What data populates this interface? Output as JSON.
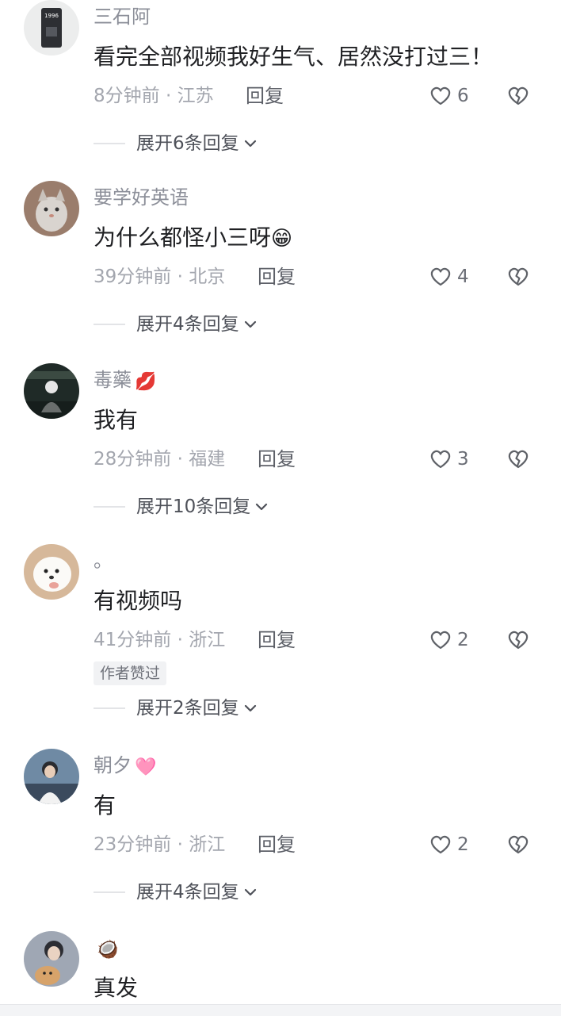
{
  "comments": [
    {
      "username": "三石阿",
      "badge": "",
      "text": "看完全部视频我好生气、居然没打过三！",
      "emoji": "",
      "time_location": "8分钟前 · 江苏",
      "reply_label": "回复",
      "likes": "6",
      "author_liked": "",
      "expand_label": "展开6条回复",
      "avatar": "avatar-1996-card"
    },
    {
      "username": "要学好英语",
      "badge": "",
      "text": "为什么都怪小三呀",
      "emoji": "😁",
      "time_location": "39分钟前 · 北京",
      "reply_label": "回复",
      "likes": "4",
      "author_liked": "",
      "expand_label": "展开4条回复",
      "avatar": "avatar-cat"
    },
    {
      "username": "毒藥",
      "badge": "💋",
      "text": "我有",
      "emoji": "",
      "time_location": "28分钟前 · 福建",
      "reply_label": "回复",
      "likes": "3",
      "author_liked": "",
      "expand_label": "展开10条回复",
      "avatar": "avatar-figure-dark"
    },
    {
      "username": "。",
      "badge": "",
      "text": "有视频吗",
      "emoji": "",
      "time_location": "41分钟前 · 浙江",
      "reply_label": "回复",
      "likes": "2",
      "author_liked": "作者赞过",
      "expand_label": "展开2条回复",
      "avatar": "avatar-white-dog"
    },
    {
      "username": "朝夕",
      "badge": "🩷",
      "text": "有",
      "emoji": "",
      "time_location": "23分钟前 · 浙江",
      "reply_label": "回复",
      "likes": "2",
      "author_liked": "",
      "expand_label": "展开4条回复",
      "avatar": "avatar-person"
    },
    {
      "username": "",
      "badge": "🥥",
      "text": "真发",
      "emoji": "",
      "time_location": "",
      "reply_label": "",
      "likes": "",
      "author_liked": "",
      "expand_label": "",
      "avatar": "avatar-pet-person"
    }
  ],
  "icons": {
    "like": "heart-outline-icon",
    "dislike": "broken-heart-icon",
    "expand": "chevron-down-icon"
  },
  "colors": {
    "username": "#8c8f99",
    "text": "#1f2023",
    "meta": "#a3a6ae"
  }
}
